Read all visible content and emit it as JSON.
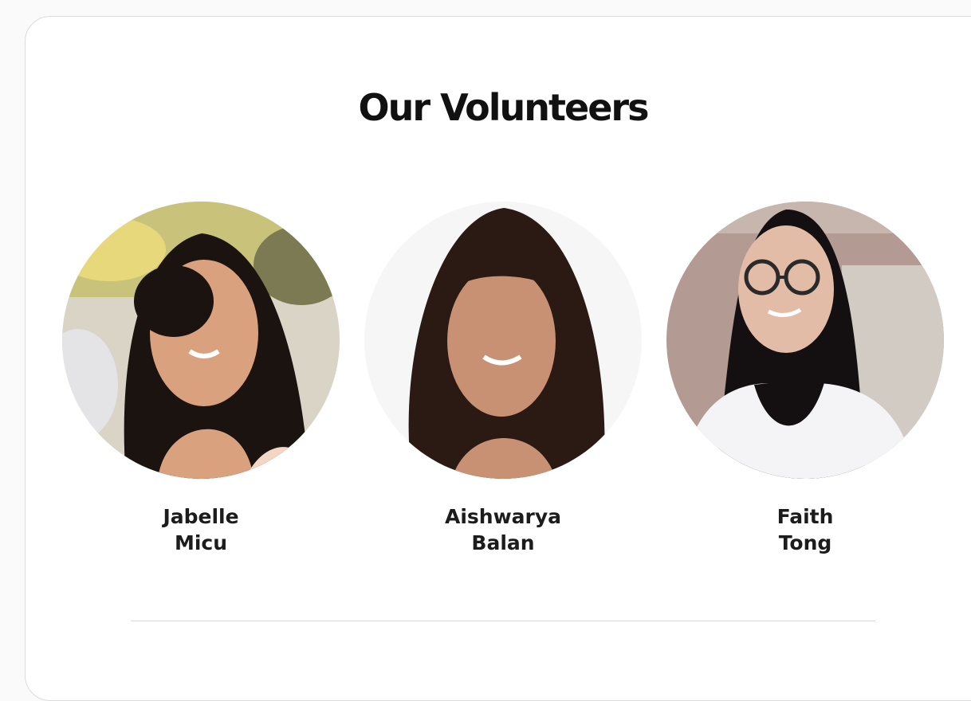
{
  "section": {
    "title": "Our Volunteers"
  },
  "volunteers": [
    {
      "first": "Jabelle",
      "last": "Micu",
      "photo": "jabelle-micu-photo"
    },
    {
      "first": "Aishwarya",
      "last": "Balan",
      "photo": "aishwarya-balan-photo"
    },
    {
      "first": "Faith",
      "last": "Tong",
      "photo": "faith-tong-photo"
    }
  ],
  "colors": {
    "background": "#ffffff",
    "title": "#111111",
    "name": "#1c1c1c",
    "divider": "#d6d6d6"
  }
}
